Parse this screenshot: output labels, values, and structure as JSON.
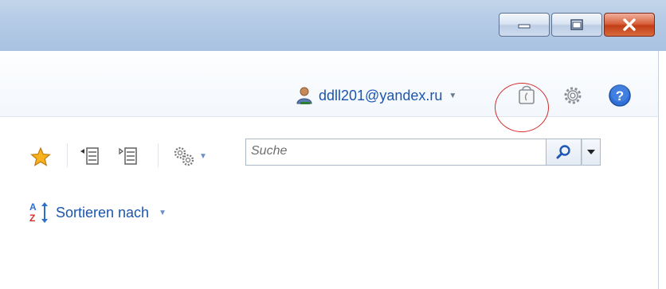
{
  "window": {
    "minimize_icon": "minimize-icon",
    "maximize_icon": "maximize-icon",
    "close_icon": "close-icon"
  },
  "account": {
    "email": "ddll201@yandex.ru",
    "dropdown_arrow": "▼"
  },
  "header_icons": [
    "shopping-bag-icon",
    "settings-gear-icon",
    "help-icon"
  ],
  "search": {
    "placeholder": "Suche",
    "value": ""
  },
  "toolbar": {
    "icons": [
      "favorites-star-icon",
      "outdent-list-icon",
      "indent-list-icon",
      "tools-gears-icon"
    ],
    "tools_arrow": "▼"
  },
  "sort": {
    "label": "Sortieren nach",
    "arrow": "▼"
  },
  "colors": {
    "link": "#1a56b0",
    "highlight_circle": "#d42c2c",
    "close_button": "#c33d17",
    "titlebar": "#b5cbe6"
  }
}
